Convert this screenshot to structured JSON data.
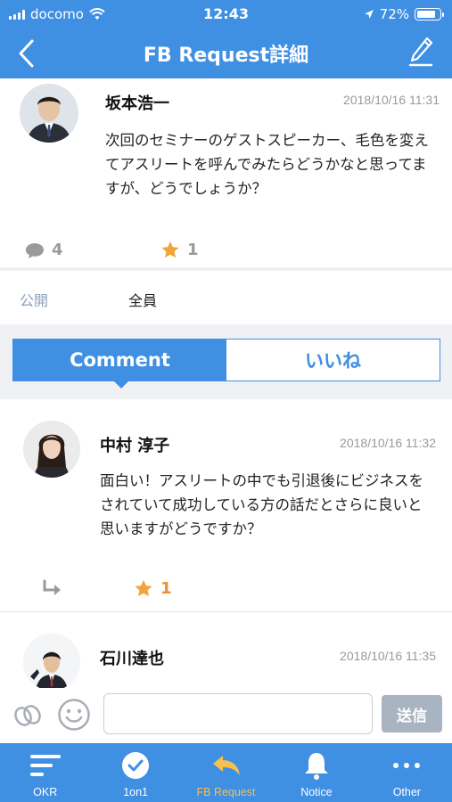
{
  "status_bar": {
    "carrier": "docomo",
    "time": "12:43",
    "battery_percent": "72%",
    "battery_level": 0.72
  },
  "header": {
    "title": "FB Request詳細",
    "back_icon": "chevron-left-icon",
    "edit_icon": "pencil-icon"
  },
  "post": {
    "author": "坂本浩一",
    "date": "2018/10/16 11:31",
    "body": "次回のセミナーのゲストスピーカー、毛色を変えてアスリートを呼んでみたらどうかなと思ってますが、どうでしょうか？",
    "comment_count": "4",
    "star_count": "1"
  },
  "visibility": {
    "label": "公開",
    "value": "全員"
  },
  "tabs": [
    {
      "label": "Comment",
      "active": true
    },
    {
      "label": "いいね",
      "active": false
    }
  ],
  "comments": [
    {
      "author": "中村 淳子",
      "date": "2018/10/16 11:32",
      "body": "面白い！アスリートの中でも引退後にビジネスをされていて成功している方の話だとさらに良いと思いますがどうですか？",
      "star_count": "1"
    },
    {
      "author": "石川達也",
      "date": "2018/10/16 11:35"
    }
  ],
  "input": {
    "value": "",
    "placeholder": "",
    "send_label": "送信"
  },
  "tabbar": [
    {
      "label": "OKR",
      "icon": "okr-lines-icon",
      "active": false
    },
    {
      "label": "1on1",
      "icon": "check-circle-icon",
      "active": false
    },
    {
      "label": "FB Request",
      "icon": "reply-arrow-icon",
      "active": true
    },
    {
      "label": "Notice",
      "icon": "bell-icon",
      "active": false
    },
    {
      "label": "Other",
      "icon": "more-dots-icon",
      "active": false
    }
  ],
  "colors": {
    "primary": "#3f8fe3",
    "star": "#e8912e",
    "active_tab": "#f5c04e",
    "send_disabled": "#a9b4c2"
  }
}
